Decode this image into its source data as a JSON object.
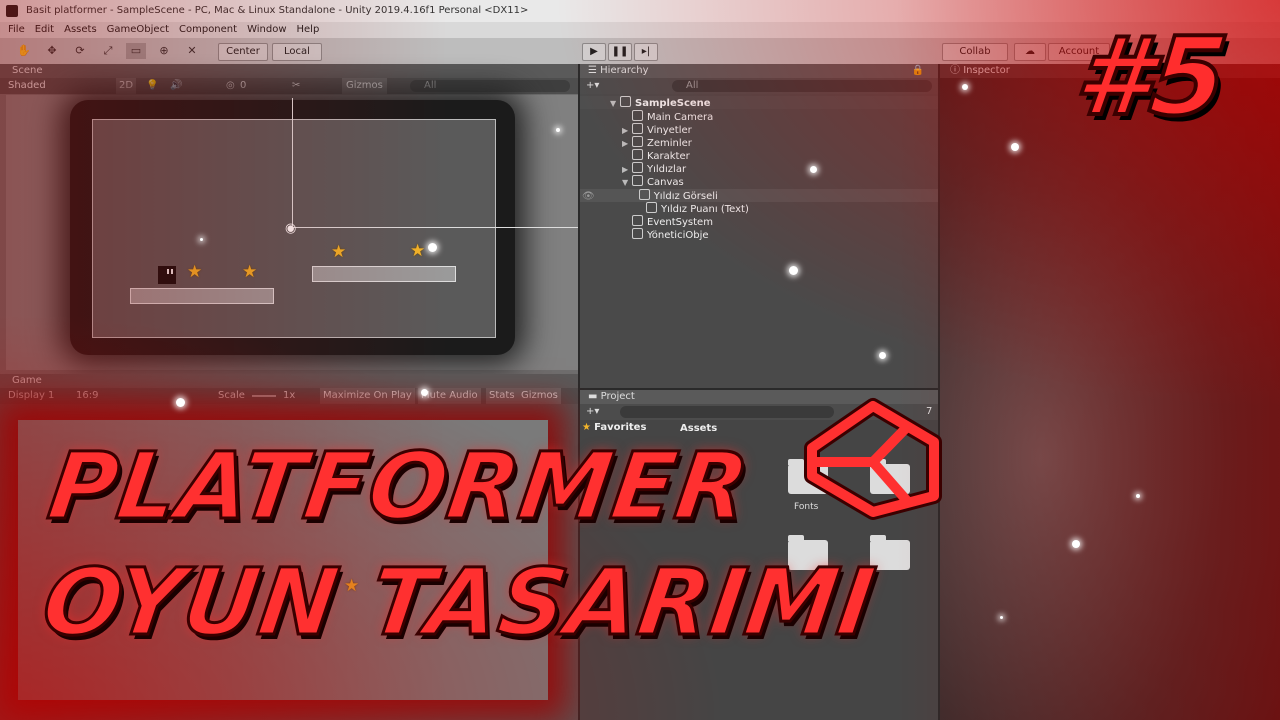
{
  "window": {
    "title": "Basit platformer - SampleScene - PC, Mac & Linux Standalone - Unity 2019.4.16f1 Personal <DX11>"
  },
  "menu": [
    "File",
    "Edit",
    "Assets",
    "GameObject",
    "Component",
    "Window",
    "Help"
  ],
  "toolbar": {
    "center_label": "Center",
    "local_label": "Local",
    "collab_label": "Collab",
    "account_label": "Account"
  },
  "scene_panel": {
    "tab": "Scene",
    "shading": "Shaded",
    "twod": "2D",
    "layers_count": "0",
    "gizmos": "Gizmos",
    "search_placeholder": "All"
  },
  "game_panel": {
    "tab": "Game",
    "display": "Display 1",
    "aspect": "16:9",
    "scale_label": "Scale",
    "scale_value": "1x",
    "maximize_label": "Maximize On Play",
    "mute_label": "Mute Audio",
    "stats_label": "Stats",
    "gizmos_label": "Gizmos"
  },
  "hierarchy": {
    "tab": "Hierarchy",
    "search_placeholder": "All",
    "items": [
      {
        "label": "SampleScene",
        "expanded": true
      },
      {
        "label": "Main Camera"
      },
      {
        "label": "Vinyetler",
        "collapsed": true
      },
      {
        "label": "Zeminler",
        "collapsed": true
      },
      {
        "label": "Karakter"
      },
      {
        "label": "Yıldızlar",
        "collapsed": true
      },
      {
        "label": "Canvas",
        "expanded": true
      },
      {
        "label": "Yıldız Görseli"
      },
      {
        "label": "Yıldız Puanı (Text)"
      },
      {
        "label": "EventSystem"
      },
      {
        "label": "YöneticiObje"
      }
    ]
  },
  "inspector": {
    "tab": "Inspector"
  },
  "project": {
    "tab": "Project",
    "favorites_label": "Favorites",
    "assets_label": "Assets",
    "folders": [
      "Fonts"
    ],
    "count_badge": "7"
  },
  "overlay": {
    "episode": "#5",
    "line1": "PLATFORMER",
    "line2": "OYUN TASARIMI"
  },
  "colors": {
    "accent_red": "#ff2d2d",
    "star": "#f2b42a"
  }
}
